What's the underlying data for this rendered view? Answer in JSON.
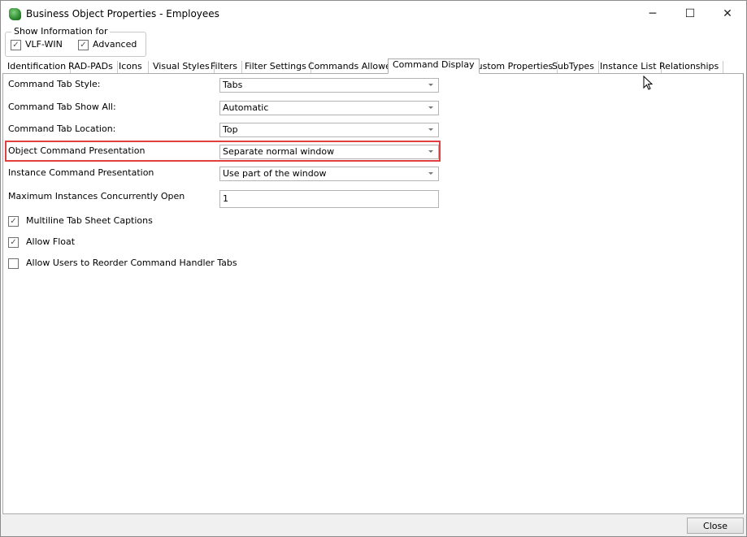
{
  "window": {
    "title": "Business Object Properties - Employees",
    "icon": "puzzle-icon",
    "controls": {
      "minimize": "─",
      "maximize": "☐",
      "close": "✕"
    }
  },
  "show_info": {
    "legend": "Show Information for",
    "options": [
      {
        "label": "VLF-WIN",
        "checked": true
      },
      {
        "label": "Advanced",
        "checked": true
      }
    ]
  },
  "tabs": [
    "Identification",
    "RAD-PADs",
    "Icons",
    "Visual Styles",
    "Filters",
    "Filter Settings",
    "Commands Allowed",
    "Command Display",
    "Custom Properties",
    "SubTypes",
    "Instance List",
    "Relationships"
  ],
  "active_tab": "Command Display",
  "fields": [
    {
      "label": "Command Tab Style:",
      "value": "Tabs"
    },
    {
      "label": "Command Tab Show All:",
      "value": "Automatic"
    },
    {
      "label": "Command Tab Location:",
      "value": "Top"
    },
    {
      "label": "Object Command Presentation",
      "value": "Separate normal window"
    },
    {
      "label": "Instance Command Presentation",
      "value": "Use part of the window"
    },
    {
      "label": "Maximum Instances Concurrently Open",
      "value": "1"
    }
  ],
  "checkboxes": [
    {
      "label": "Multiline Tab Sheet Captions",
      "checked": true
    },
    {
      "label": "Allow Float",
      "checked": true
    },
    {
      "label": "Allow Users to Reorder Command Handler Tabs",
      "checked": false
    }
  ],
  "check_glyph": "✓",
  "highlight_color": "#e04040",
  "footer": {
    "close_label": "Close"
  }
}
